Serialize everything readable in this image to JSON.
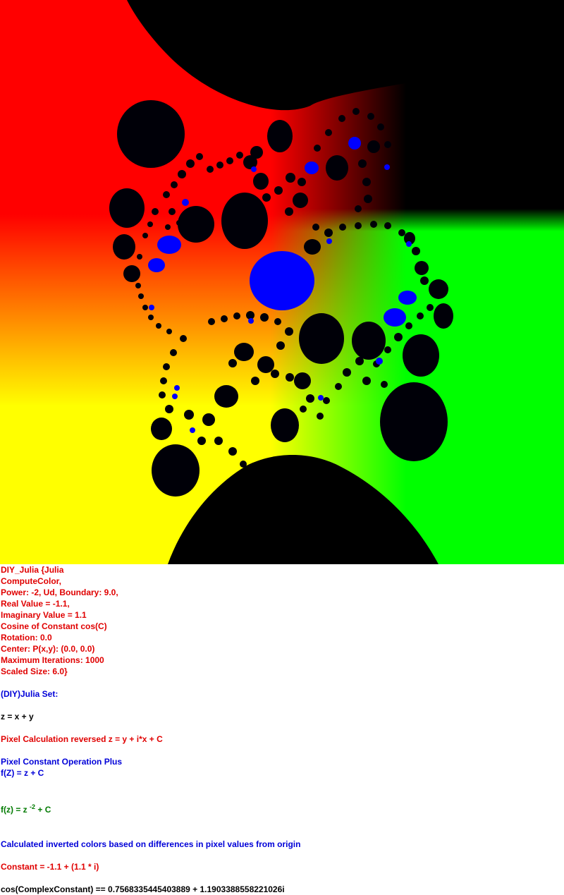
{
  "fractal_image": {
    "icon": "julia-set-fractal",
    "colors": {
      "top_left": "#ff0000",
      "bottom_left": "#ffff00",
      "bottom_right": "#00ff00",
      "top_right": "#000000",
      "set_interior": "#000008",
      "highlight": "#0000ff"
    }
  },
  "info": {
    "title": "DIY_Julia {Julia",
    "compute_color": "ComputeColor,",
    "power_line": "Power: -2, Ud, Boundary: 9.0,",
    "real_value": "Real Value = -1.1,",
    "imaginary_value": "Imaginary Value = 1.1",
    "cosine": "Cosine of Constant cos(C)",
    "rotation": "Rotation: 0.0",
    "center": "Center: P(x,y): (0.0, 0.0)",
    "max_iterations": "Maximum Iterations: 1000",
    "scaled_size": "Scaled Size: 6.0}",
    "set_type": "(DIY)Julia Set:",
    "z_def": "z = x + y",
    "pixel_calc": "Pixel Calculation reversed z = y + i*x + C",
    "pixel_const_op": "Pixel Constant Operation Plus",
    "fz": "f(Z) = z + C",
    "formula_prefix": "f(z) = z",
    "formula_exponent": "-2",
    "formula_suffix": " + C",
    "colors_desc": "Calculated inverted colors based on differences in pixel values from origin",
    "constant": "Constant = -1.1 + (1.1 * i)",
    "cos_value": "cos(ComplexConstant) == 0.7568335445403889 + 1.1903388558221026i"
  }
}
